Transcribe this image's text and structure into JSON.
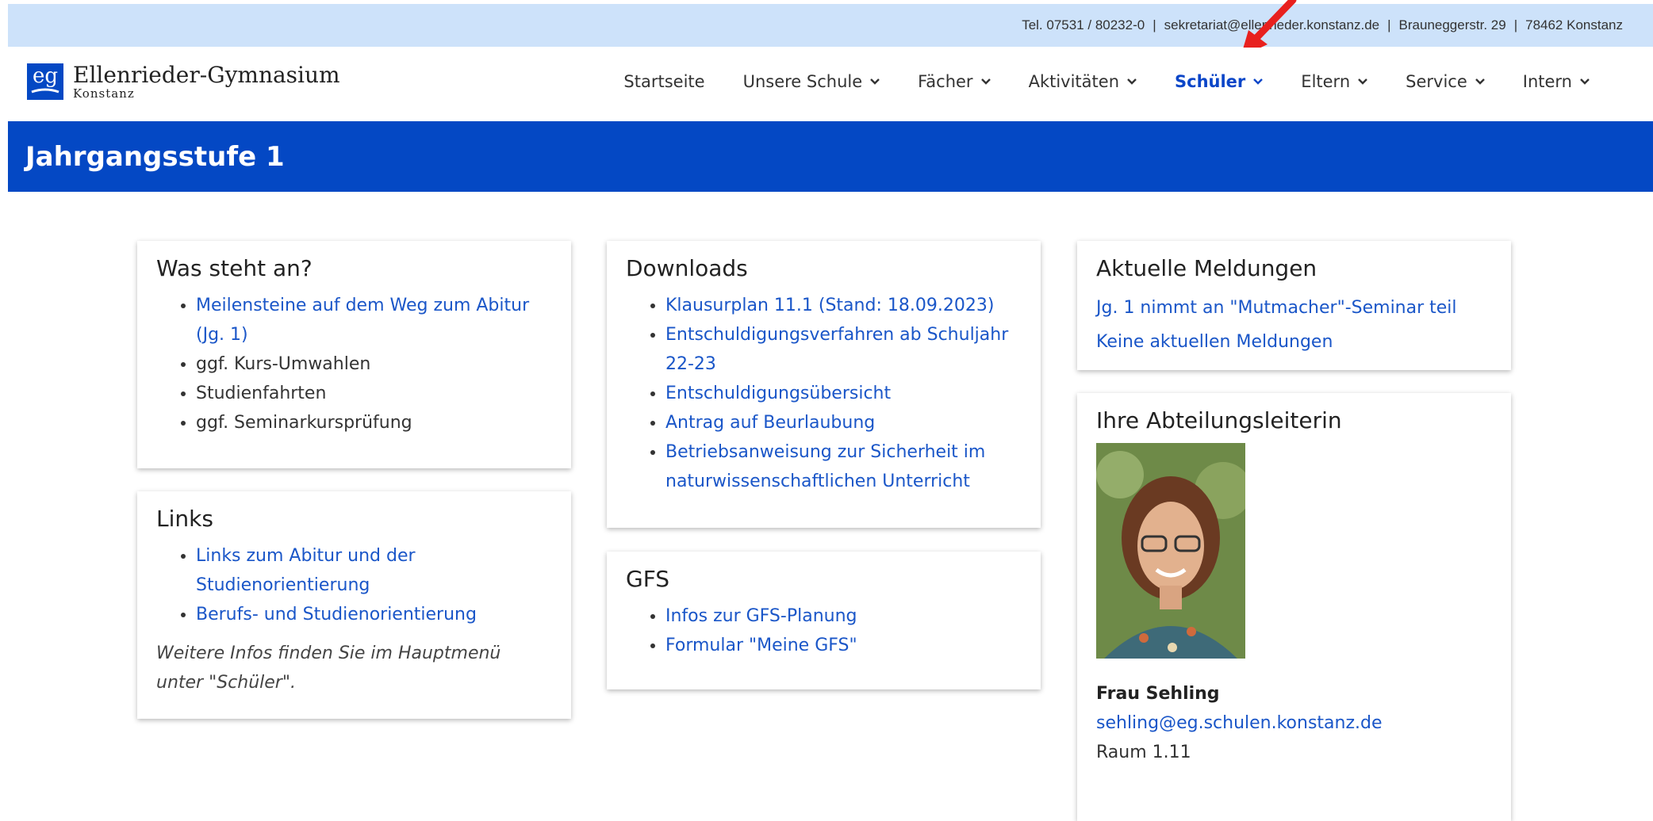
{
  "topbar": {
    "phone": "Tel. 07531 / 80232-0",
    "email": "sekretariat@ellenrieder.konstanz.de",
    "street": "Brauneggerstr. 29",
    "city": "78462 Konstanz",
    "separator": "|"
  },
  "logo": {
    "title": "Ellenrieder-Gymnasium",
    "subtitle": "Konstanz",
    "mark": "eg"
  },
  "nav": {
    "items": [
      {
        "label": "Startseite",
        "dropdown": false,
        "active": false
      },
      {
        "label": "Unsere Schule",
        "dropdown": true,
        "active": false
      },
      {
        "label": "Fächer",
        "dropdown": true,
        "active": false
      },
      {
        "label": "Aktivitäten",
        "dropdown": true,
        "active": false
      },
      {
        "label": "Schüler",
        "dropdown": true,
        "active": true
      },
      {
        "label": "Eltern",
        "dropdown": true,
        "active": false
      },
      {
        "label": "Service",
        "dropdown": true,
        "active": false
      },
      {
        "label": "Intern",
        "dropdown": true,
        "active": false
      }
    ]
  },
  "page": {
    "title": "Jahrgangsstufe 1"
  },
  "cards": {
    "was_steht_an": {
      "title": "Was steht an?",
      "items": [
        {
          "text": "Meilensteine auf dem Weg zum Abitur (Jg. 1)",
          "link": true
        },
        {
          "text": "ggf. Kurs-Umwahlen",
          "link": false
        },
        {
          "text": "Studienfahrten",
          "link": false
        },
        {
          "text": "ggf. Seminarkursprüfung",
          "link": false
        }
      ]
    },
    "links": {
      "title": "Links",
      "items": [
        {
          "text": "Links zum Abitur und der Studienorientierung",
          "link": true
        },
        {
          "text": "Berufs- und Studienorientierung",
          "link": true
        }
      ],
      "note": "Weitere Infos finden Sie im Hauptmenü unter \"Schüler\"."
    },
    "downloads": {
      "title": "Downloads",
      "items": [
        {
          "text": "Klausurplan 11.1 (Stand: 18.09.2023)",
          "link": true
        },
        {
          "text": "Entschuldigungsverfahren ab Schuljahr 22-23",
          "link": true
        },
        {
          "text": "Entschuldigungsübersicht",
          "link": true
        },
        {
          "text": "Antrag auf Beurlaubung",
          "link": true
        },
        {
          "text": "Betriebsanweisung zur Sicherheit im naturwissenschaftlichen Unterricht",
          "link": true
        }
      ]
    },
    "gfs": {
      "title": "GFS",
      "items": [
        {
          "text": "Infos zur GFS-Planung",
          "link": true
        },
        {
          "text": "Formular \"Meine GFS\"",
          "link": true
        }
      ]
    },
    "meldungen": {
      "title": "Aktuelle Meldungen",
      "lines": [
        "Jg. 1 nimmt an \"Mutmacher\"-Seminar teil",
        "Keine aktuellen Meldungen"
      ]
    },
    "abteilung": {
      "title": "Ihre Abteilungsleiterin",
      "name": "Frau Sehling",
      "email": "sehling@eg.schulen.konstanz.de",
      "room": "Raum 1.11"
    }
  },
  "colors": {
    "topbar_bg": "#cde2fa",
    "band_bg": "#0448c4",
    "link": "#1a56c8",
    "nav_active": "#0b46c8",
    "arrow": "#e8201e"
  }
}
